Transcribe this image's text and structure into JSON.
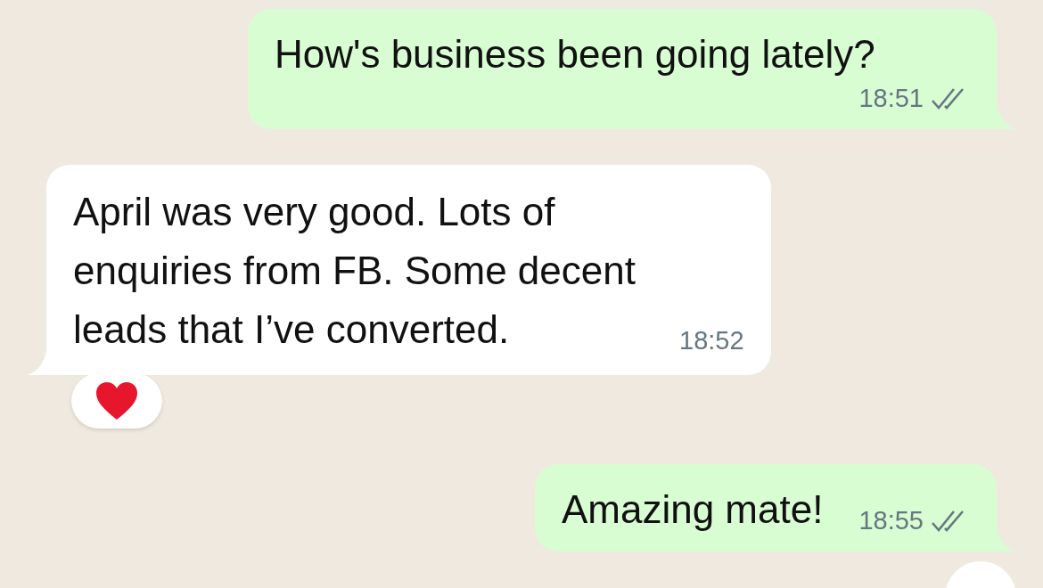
{
  "messages": [
    {
      "mine": true,
      "text": "How's business been going lately?",
      "time": "18:51",
      "read": false
    },
    {
      "mine": false,
      "text": "April was very good. Lots of enquiries from FB. Some decent leads that I’ve converted.",
      "time": "18:52",
      "reaction": {
        "kind": "heart"
      }
    },
    {
      "mine": true,
      "text": "Amazing mate!",
      "time": "18:55",
      "read": false
    }
  ]
}
